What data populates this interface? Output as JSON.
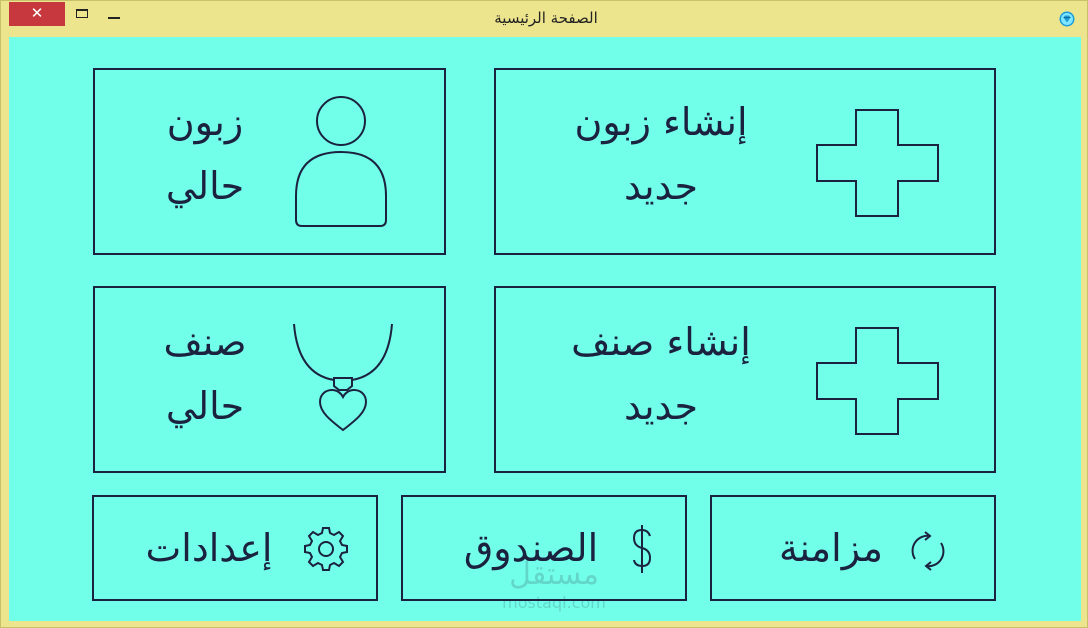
{
  "window": {
    "title": "الصفحة الرئيسية",
    "close_symbol": "✕",
    "app_icon": "diamond-icon"
  },
  "tiles": {
    "new_customer": {
      "line1": "إنشاء زبون",
      "line2": "جديد",
      "icon": "plus-icon"
    },
    "existing_customer": {
      "line1": "زبون",
      "line2": "حالي",
      "icon": "person-icon"
    },
    "new_item": {
      "line1": "إنشاء صنف",
      "line2": "جديد",
      "icon": "plus-icon"
    },
    "existing_item": {
      "line1": "صنف",
      "line2": "حالي",
      "icon": "necklace-heart-icon"
    }
  },
  "bottom_buttons": {
    "sync": {
      "label": "مزامنة",
      "icon": "sync-icon"
    },
    "cashbox": {
      "label": "الصندوق",
      "icon": "dollar-icon"
    },
    "settings": {
      "label": "إعدادات",
      "icon": "gear-icon"
    }
  },
  "watermark": {
    "arabic": "مستقل",
    "latin": "mostaql.com"
  },
  "colors": {
    "background": "#72ffe9",
    "frame": "#ede58e",
    "ink": "#1b2240",
    "close_button": "#c7383e"
  }
}
